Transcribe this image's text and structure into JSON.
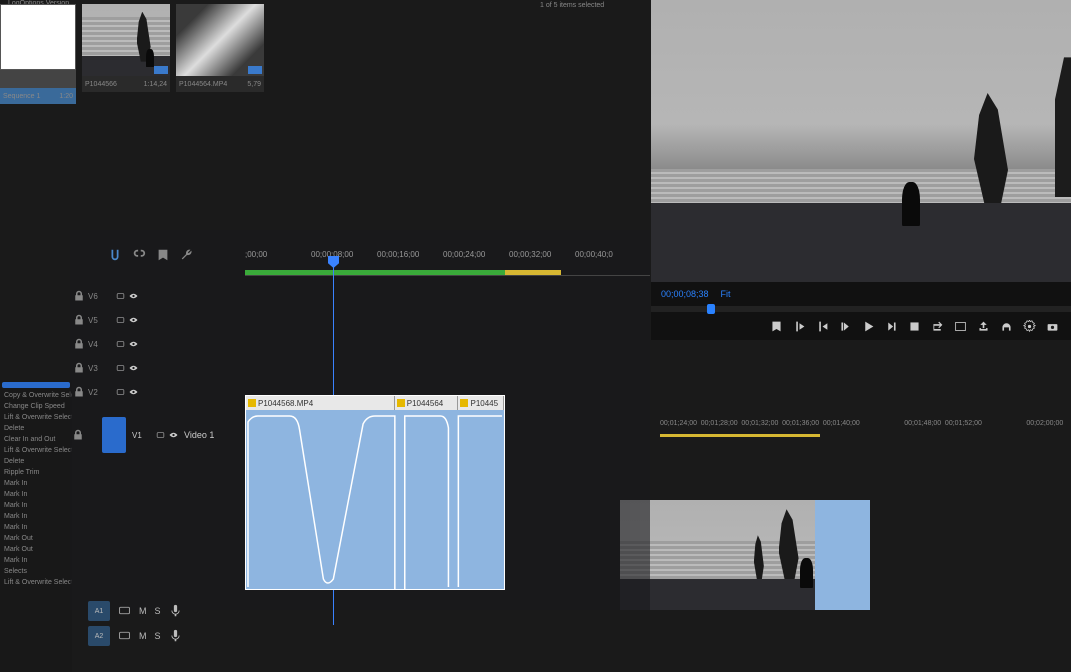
{
  "project": {
    "header": "LogOptions Version",
    "selection_info": "1 of 5 items selected",
    "thumbs": [
      {
        "name": "Sequence 1",
        "dur": "1:20"
      },
      {
        "name": "P1044566",
        "dur": "1:14,24"
      },
      {
        "name": "P1044564.MP4",
        "dur": "5,79"
      }
    ]
  },
  "preview": {
    "timecode": "00;00;08;38",
    "fit": "Fit"
  },
  "timeline": {
    "ruler": [
      ";00;00",
      "00;00;08;00",
      "00;00;16;00",
      "00;00;24;00",
      "00;00;32;00",
      "00;00;40;0"
    ],
    "tracks": [
      "V6",
      "V5",
      "V4",
      "V3",
      "V2"
    ],
    "v1": {
      "label": "V1",
      "name": "Video 1"
    },
    "audio": [
      {
        "label": "A1",
        "mute": "M",
        "solo": "S"
      },
      {
        "label": "A2",
        "mute": "M",
        "solo": "S"
      }
    ],
    "clips": [
      "P1044568.MP4",
      "P1044564",
      "P10445"
    ]
  },
  "lower_timeline": {
    "ticks": [
      "00;01;24;00",
      "00;01;28;00",
      "00;01;32;00",
      "00;01;36;00",
      "00;01;40;00",
      "",
      "00;01;48;00",
      "00;01;52;00",
      "",
      "00;02;00;00"
    ]
  },
  "context_menu": [
    "Copy & Overwrite Selection",
    "Change Clip Speed",
    "Lift & Overwrite Selection",
    "Delete",
    "Clear In and Out",
    "Lift & Overwrite Selection",
    "Delete",
    "Ripple Trim",
    "Mark In",
    "Mark In",
    "Mark In",
    "Mark In",
    "Mark In",
    "Mark Out",
    "Mark Out",
    "Mark In",
    "Selects",
    "Lift & Overwrite Selection"
  ]
}
